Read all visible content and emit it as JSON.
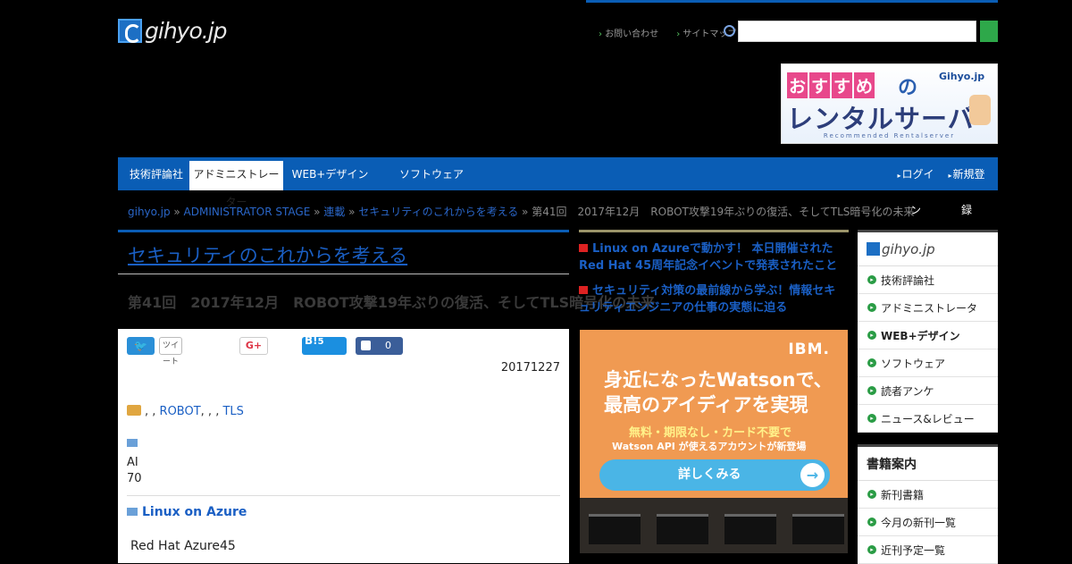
{
  "header": {
    "logo_text": "gihyo.jp",
    "links": [
      "お問い合わせ",
      "サイトマップ"
    ],
    "search_placeholder": "",
    "ad": {
      "pink_chars": [
        "お",
        "す",
        "す",
        "め"
      ],
      "no": "の",
      "brand": "Gihyo.jp",
      "big": "レンタルサーバ",
      "sub": "Recommended Rentalserver"
    }
  },
  "nav": {
    "items": [
      "技術評論社",
      "アドミニストレーター",
      "WEB+デザイン",
      "ソフトウェア"
    ],
    "right": [
      "ログイン",
      "新規登録"
    ]
  },
  "breadcrumb": {
    "items": [
      "gihyo.jp",
      "ADMINISTRATOR STAGE",
      "連載",
      "セキュリティのこれからを考える"
    ],
    "current": "第41回　2017年12月　ROBOT攻撃19年ぶりの復活、そしてTLS暗号化の未来"
  },
  "article": {
    "series_title": "セキュリティのこれからを考える",
    "title": "第41回　2017年12月　ROBOT攻撃19年ぶりの復活、そしてTLS暗号化の未来",
    "share": {
      "twitter_icon": "twitter-icon",
      "tweet_count": "ツイート",
      "gplus": "G+",
      "hatena": "B!",
      "hatena_count": "5",
      "fb_count": "0"
    },
    "date": "20171227",
    "tags_prefix": ", , ",
    "tag_robot": "ROBOT",
    "tags_mid": ", , , ",
    "tag_tls": "TLS",
    "body": [
      "AI",
      "70"
    ],
    "linux_head": "Linux on Azure",
    "linux_body": "Red Hat Azure45"
  },
  "middle": {
    "news": [
      "Linux on Azureで動かす！ 本日開催されたRed Hat 45周年記念イベントで発表されたこと",
      "セキュリティ対策の最前線から学ぶ！情報セキュリティエンジニアの仕事の実態に迫る"
    ],
    "watson": {
      "ibm": "IBM.",
      "headline1": "身近になったWatsonで、",
      "headline2": "最高のアイディアを実現",
      "free": "無料・期限なし・カード不要で",
      "api": "Watson API が使えるアカウントが新登場",
      "cta": "詳しくみる",
      "arrow": "→"
    }
  },
  "sidebar": {
    "logo_text": "gihyo.jp",
    "items": [
      "技術評論社",
      "アドミニストレータ",
      "WEB+デザイン",
      "ソフトウェア",
      "読者アンケ",
      "ニュース&レビュー"
    ],
    "box2_title": "書籍案内",
    "items2": [
      "新刊書籍",
      "今月の新刊一覧",
      "近刊予定一覧"
    ]
  }
}
